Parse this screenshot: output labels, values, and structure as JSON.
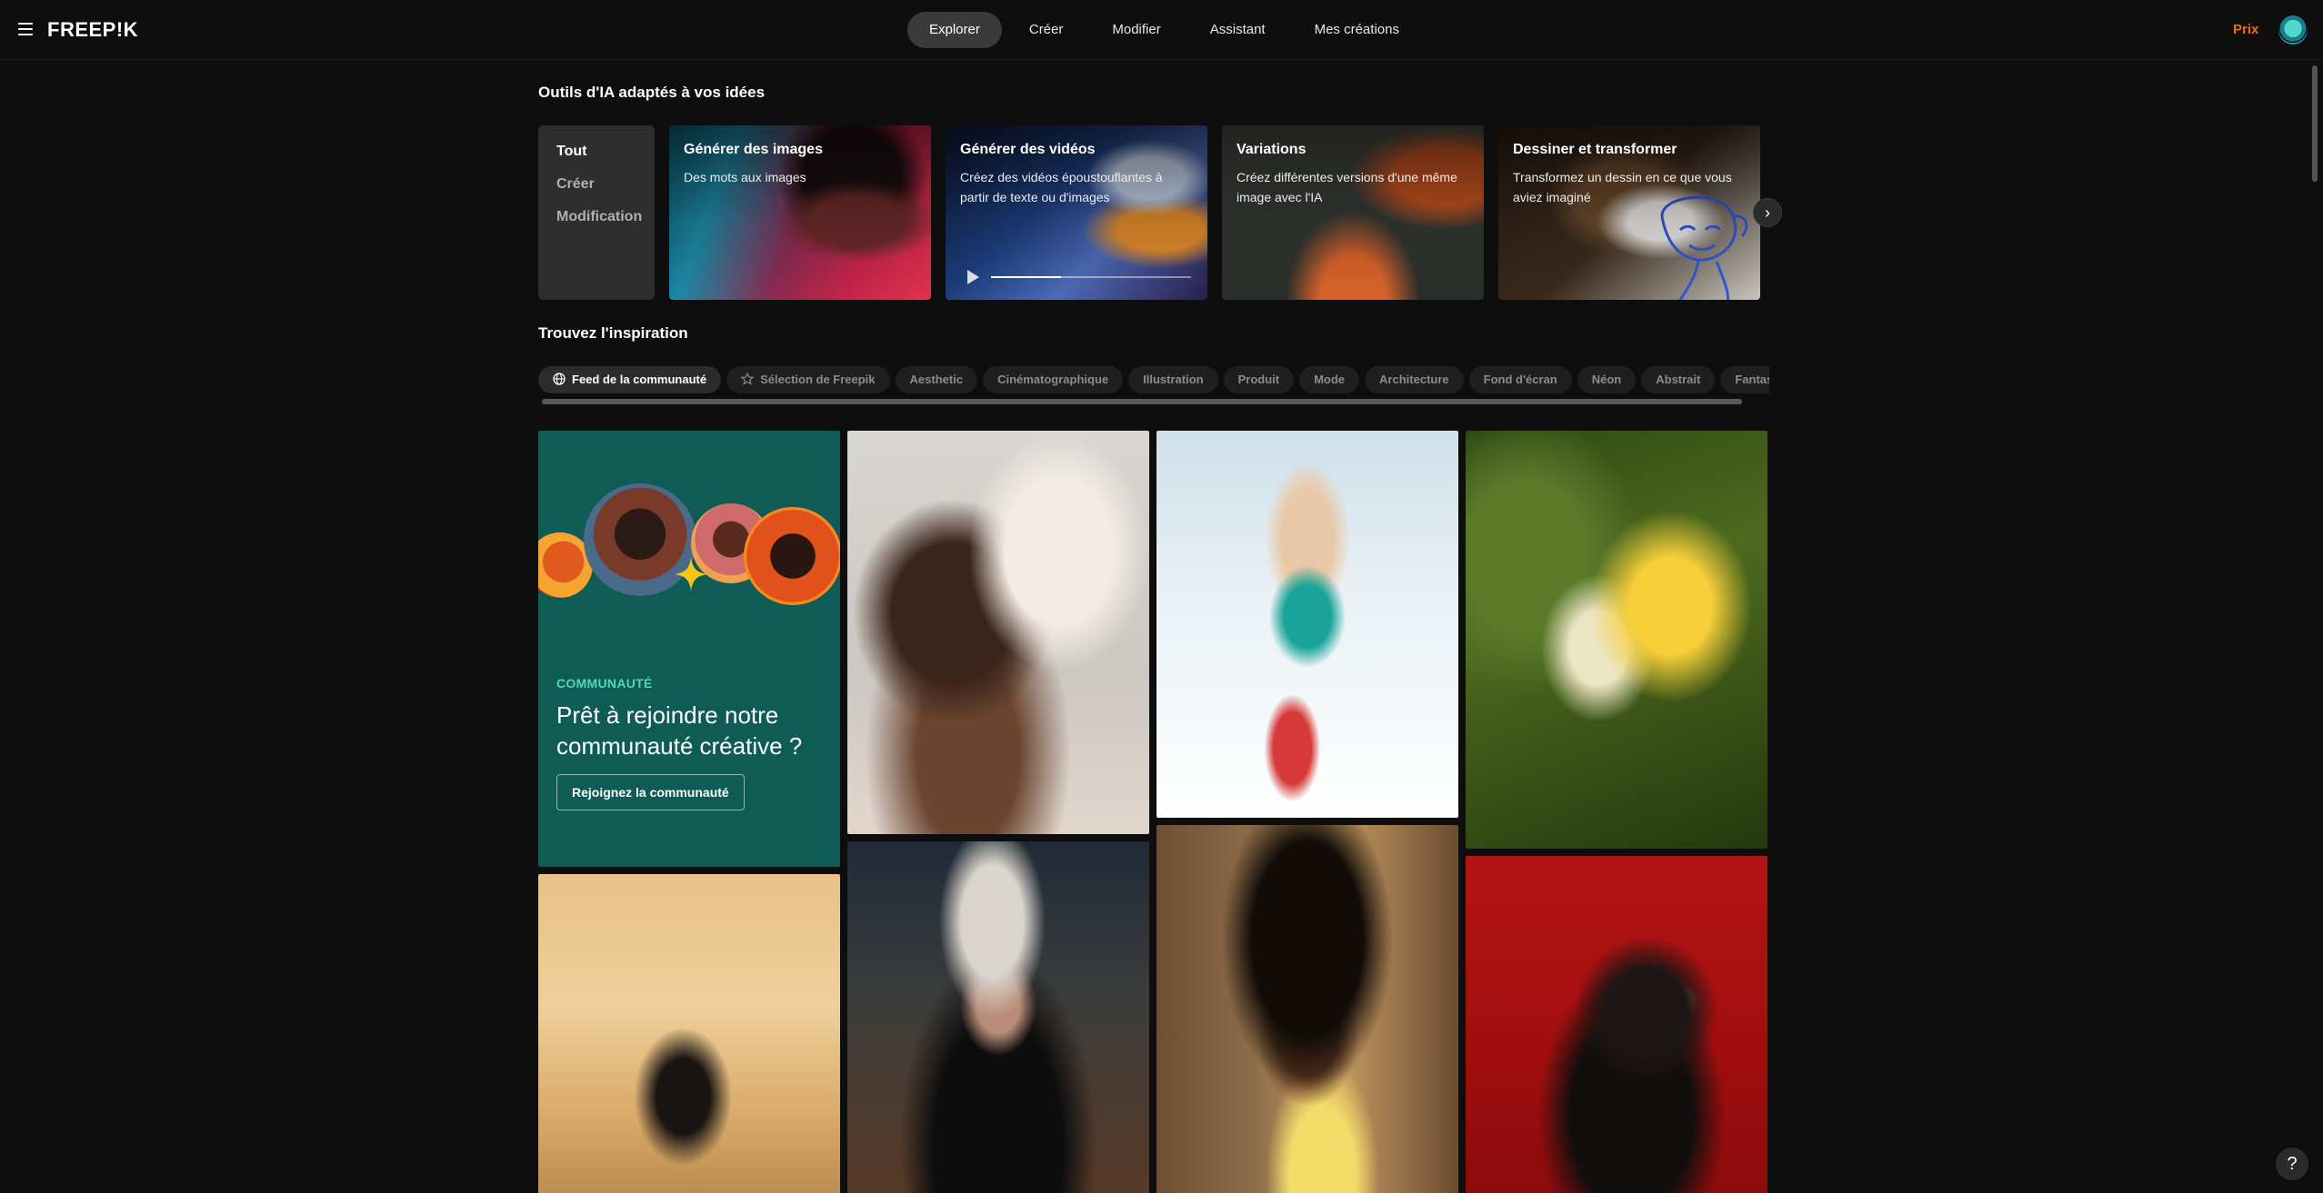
{
  "header": {
    "logo": "FREEP!K",
    "nav": [
      "Explorer",
      "Créer",
      "Modifier",
      "Assistant",
      "Mes créations"
    ],
    "active_nav": "Explorer",
    "prix": "Prix"
  },
  "tools": {
    "title": "Outils d'IA adaptés à vos idées",
    "filters": [
      "Tout",
      "Créer",
      "Modification"
    ],
    "active_filter": "Tout",
    "cards": [
      {
        "title": "Générer des images",
        "desc": "Des mots aux images"
      },
      {
        "title": "Générer des vidéos",
        "desc": "Créez des vidéos époustouflantes à partir de texte ou d'images"
      },
      {
        "title": "Variations",
        "desc": "Créez différentes versions d'une même image avec l'IA"
      },
      {
        "title": "Dessiner et transformer",
        "desc": "Transformez un dessin en ce que vous aviez imaginé"
      }
    ],
    "next_icon": "chevron-right-icon"
  },
  "inspiration": {
    "title": "Trouvez l'inspiration",
    "chips": [
      "Feed de la communauté",
      "Sélection de Freepik",
      "Aesthetic",
      "Cinématographique",
      "Illustration",
      "Produit",
      "Mode",
      "Architecture",
      "Fond d'écran",
      "Néon",
      "Abstrait",
      "Fantastique"
    ],
    "active_chip": "Feed de la communauté"
  },
  "community": {
    "label": "COMMUNAUTÉ",
    "title": "Prêt à rejoindre notre communauté créative ?",
    "button": "Rejoignez la communauté"
  },
  "colors": {
    "accent_orange": "#f06a1a",
    "community_bg": "#0f5c57",
    "community_label": "#4fd8b6"
  },
  "help_label": "?"
}
